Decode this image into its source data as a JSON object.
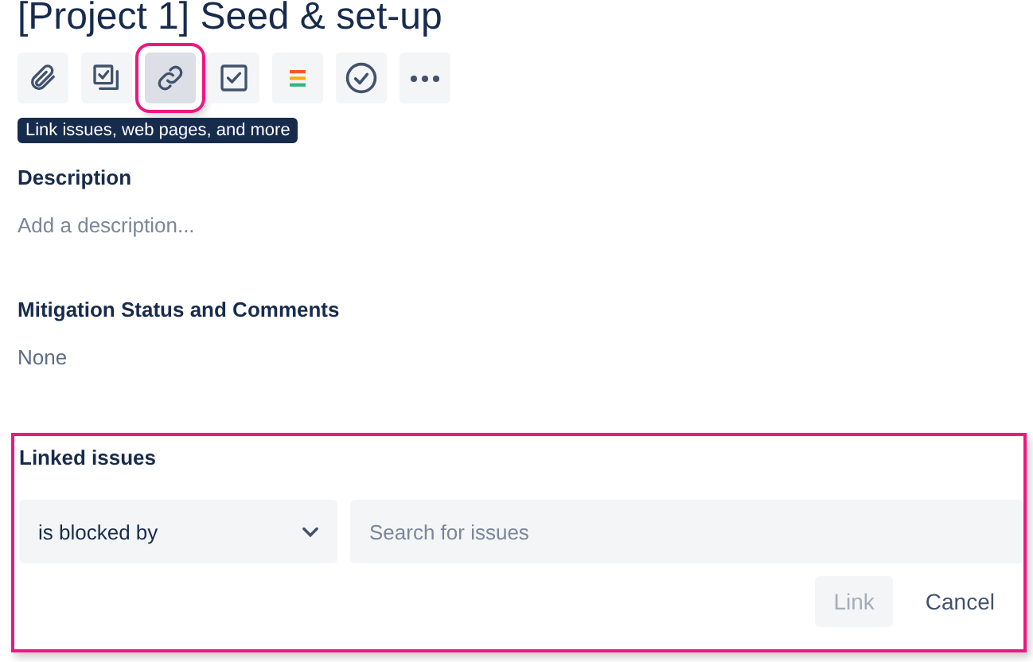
{
  "title": "[Project 1] Seed & set-up",
  "toolbar": [
    {
      "kind": "attach",
      "highlighted": false
    },
    {
      "kind": "subtask",
      "highlighted": false
    },
    {
      "kind": "link",
      "highlighted": true
    },
    {
      "kind": "checkbox",
      "highlighted": false
    },
    {
      "kind": "bars",
      "highlighted": false
    },
    {
      "kind": "check-circle",
      "highlighted": false
    },
    {
      "kind": "more",
      "highlighted": false
    }
  ],
  "tooltip": "Link issues, web pages, and more",
  "fields": [
    {
      "label": "Description",
      "value": "Add a description...",
      "kind": "placeholder"
    },
    {
      "label": "Mitigation Status and Comments",
      "value": "None",
      "kind": "value"
    }
  ],
  "linked_issues": {
    "label": "Linked issues",
    "highlighted": true,
    "relation": "is blocked by",
    "search": {
      "placeholder": "Search for issues"
    },
    "link_button": {
      "label": "Link",
      "disabled": true
    },
    "cancel_button": {
      "label": "Cancel"
    }
  }
}
